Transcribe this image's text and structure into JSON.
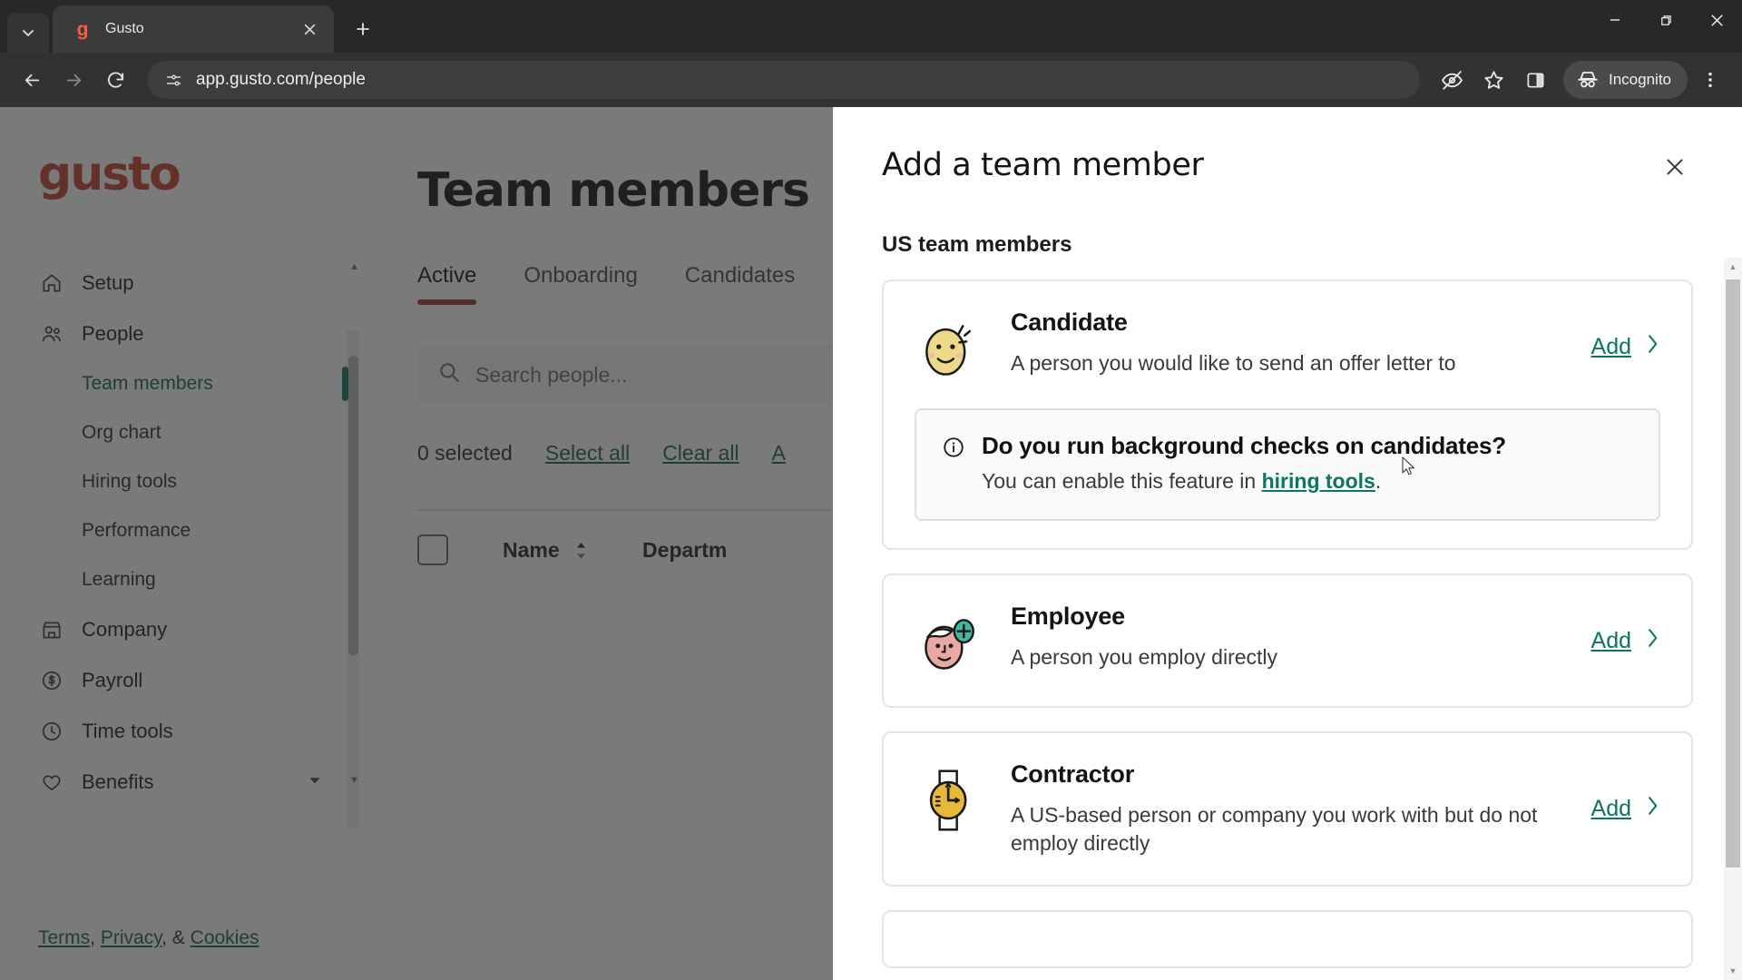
{
  "browser": {
    "tab": {
      "title": "Gusto",
      "favicon": "gusto-g-icon"
    },
    "url": "app.gusto.com/people",
    "incognito_label": "Incognito",
    "icons": {
      "tab_list": "chevron-down-icon",
      "new_tab": "plus-icon",
      "back": "back-arrow-icon",
      "forward": "forward-arrow-icon",
      "reload": "reload-icon",
      "site_info": "site-settings-icon",
      "tracking": "eye-slash-icon",
      "bookmark": "star-icon",
      "side_panel": "side-panel-icon",
      "incognito": "incognito-hat-icon",
      "menu": "three-dot-menu-icon",
      "minimize": "minimize-icon",
      "maximize": "maximize-icon",
      "close": "window-close-icon"
    }
  },
  "sidebar": {
    "logo": "gusto",
    "items": [
      {
        "label": "Setup",
        "icon": "home-icon",
        "type": "top"
      },
      {
        "label": "People",
        "icon": "people-icon",
        "type": "top"
      },
      {
        "label": "Team members",
        "type": "sub",
        "active": true
      },
      {
        "label": "Org chart",
        "type": "sub",
        "active": false
      },
      {
        "label": "Hiring tools",
        "type": "sub",
        "active": false
      },
      {
        "label": "Performance",
        "type": "sub",
        "active": false
      },
      {
        "label": "Learning",
        "type": "sub",
        "active": false
      },
      {
        "label": "Company",
        "icon": "building-icon",
        "type": "top"
      },
      {
        "label": "Payroll",
        "icon": "dollar-circle-icon",
        "type": "top"
      },
      {
        "label": "Time tools",
        "icon": "clock-icon",
        "type": "top"
      },
      {
        "label": "Benefits",
        "icon": "heart-icon",
        "type": "top",
        "chevron": true
      }
    ],
    "footer": {
      "terms": "Terms",
      "privacy": "Privacy",
      "cookies": "Cookies",
      "sep1": ", ",
      "sep2": ", & "
    }
  },
  "main": {
    "title": "Team members",
    "tabs": [
      {
        "label": "Active",
        "active": true
      },
      {
        "label": "Onboarding",
        "active": false
      },
      {
        "label": "Candidates",
        "active": false
      }
    ],
    "search_placeholder": "Search people...",
    "selection": {
      "count_label": "0 selected",
      "select_all": "Select all",
      "clear_all": "Clear all",
      "more": "A"
    },
    "table_headers": [
      "Name",
      "Departm"
    ]
  },
  "modal": {
    "title": "Add a team member",
    "close_icon": "close-icon",
    "section_label": "US team members",
    "cards": [
      {
        "title": "Candidate",
        "description": "A person you would like to send an offer letter to",
        "add_label": "Add",
        "art": "smiley-face-icon",
        "notice": {
          "icon": "info-icon",
          "title": "Do you run background checks on candidates?",
          "text_before": "You can enable this feature in ",
          "link": "hiring tools",
          "text_after": "."
        }
      },
      {
        "title": "Employee",
        "description": "A person you employ directly",
        "add_label": "Add",
        "art": "person-plus-icon"
      },
      {
        "title": "Contractor",
        "description": "A US-based person or company you work with but do not employ directly",
        "add_label": "Add",
        "art": "watch-icon"
      }
    ]
  },
  "colors": {
    "brand_red": "#c4402f",
    "accent_teal": "#0a7561",
    "tab_underline": "#9c3a2c",
    "candidate_yellow": "#eed98a",
    "employee_pink": "#e8a9a4",
    "employee_badge_teal": "#3fb8a0",
    "contractor_yellow": "#e8b838"
  }
}
